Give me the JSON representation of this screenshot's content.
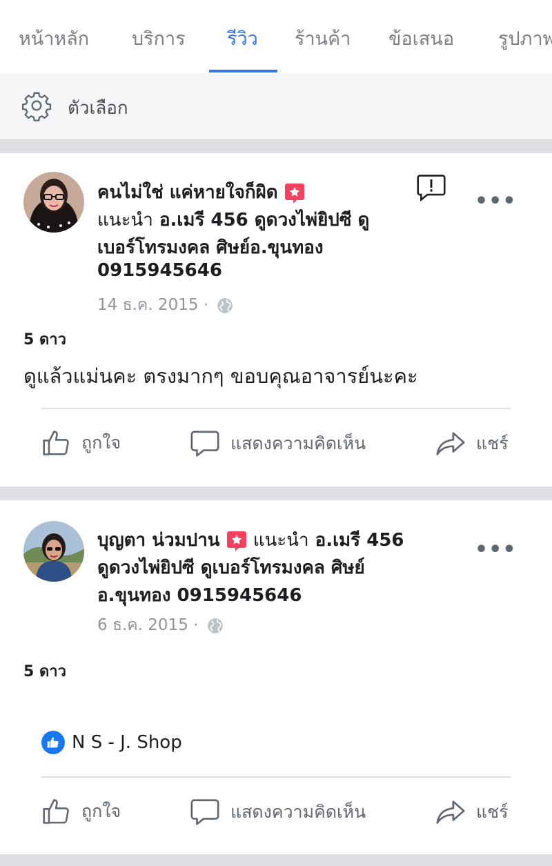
{
  "tabs": [
    {
      "label": "หน้าหลัก"
    },
    {
      "label": "บริการ"
    },
    {
      "label": "รีวิว"
    },
    {
      "label": "ร้านค้า"
    },
    {
      "label": "ข้อเสนอ"
    },
    {
      "label": "รูปภาพ"
    }
  ],
  "options": {
    "label": "ตัวเลือก"
  },
  "colors": {
    "accent": "#3578e5",
    "badge_red": "#f3425f",
    "like_blue": "#1877f2"
  },
  "reviews": [
    {
      "author": "คนไม่ใช่ แค่หายใจก็ผิด",
      "recommends": "แนะนำ",
      "page_line1": "อ.เมรี 456 ดูดวงไพ่ยิปซี ดู",
      "page_line2": "เบอร์โทรมงคล ศิษย์อ.ขุนทอง",
      "page_line3": "0915945646",
      "date": "14 ธ.ค. 2015 ·",
      "rating": "5 ดาว",
      "text": "ดูแล้วแม่นคะ ตรงมากๆ ขอบคุณอาจารย์นะคะ",
      "actions": {
        "like": "ถูกใจ",
        "comment": "แสดงความคิดเห็น",
        "share": "แชร์"
      }
    },
    {
      "author": "บุญตา น่วมปาน",
      "recommends": "แนะนำ",
      "page_line1": "อ.เมรี 456",
      "page_line2": "ดูดวงไพ่ยิปซี ดูเบอร์โทรมงคล ศิษย์",
      "page_line3": "อ.ขุนทอง 0915945646",
      "date": "6 ธ.ค. 2015 ·",
      "rating": "5 ดาว",
      "liked_by": "N S - J. Shop",
      "actions": {
        "like": "ถูกใจ",
        "comment": "แสดงความคิดเห็น",
        "share": "แชร์"
      }
    }
  ]
}
